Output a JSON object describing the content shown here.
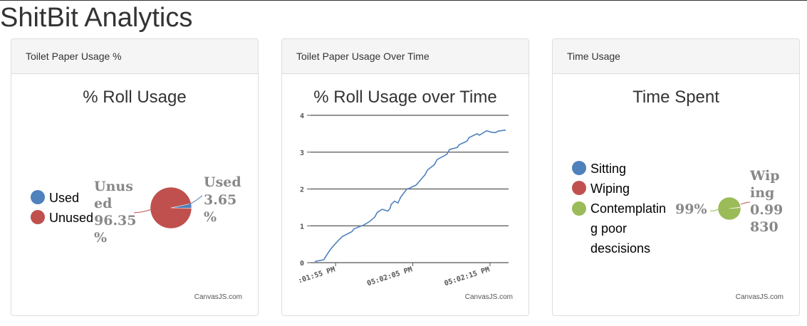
{
  "app": {
    "title": "ShitBit Analytics"
  },
  "panels": [
    {
      "heading": "Toilet Paper Usage %",
      "chart_title": "% Roll Usage",
      "credit": "CanvasJS.com"
    },
    {
      "heading": "Toilet Paper Usage Over Time",
      "chart_title": "% Roll Usage over Time",
      "credit": "CanvasJS.com"
    },
    {
      "heading": "Time Usage",
      "chart_title": "Time Spent",
      "credit": "CanvasJS.com"
    }
  ],
  "chart_data": [
    {
      "type": "pie",
      "title": "% Roll Usage",
      "legend_position": "left",
      "slices": [
        {
          "name": "Used",
          "value": 3.65,
          "color": "#4f81bc",
          "label_lines": [
            "Used",
            "3.65",
            "%"
          ]
        },
        {
          "name": "Unused",
          "value": 96.35,
          "color": "#c0504e",
          "label_lines": [
            "Unus",
            "ed",
            "96.35",
            "%"
          ]
        }
      ]
    },
    {
      "type": "line",
      "title": "% Roll Usage over Time",
      "ylim": [
        0,
        4
      ],
      "yticks": [
        "0",
        "1",
        "2",
        "3",
        "4"
      ],
      "xticks": [
        ":01:55 PM",
        "05:02:05 PM",
        "05:02:15 PM"
      ],
      "grid": true,
      "color": "#4f81bc",
      "series": [
        {
          "x": [
            0,
            1.6,
            2,
            2.6,
            3,
            4.3,
            4.9,
            6.6,
            7,
            8.7,
            9.8,
            10.7,
            11.1,
            11.5,
            12,
            13,
            13.4,
            13.6,
            14.2,
            14.8,
            15.3,
            16.4,
            16.9,
            17.2,
            18,
            19.6,
            20.1,
            21.3,
            21.8,
            23.5,
            24,
            25.4,
            25.7,
            27.1,
            27.5,
            28.9,
            29.3,
            30.6,
            31.5,
            32.2,
            32.6,
            34
          ],
          "y": [
            0.03,
            0.08,
            0.18,
            0.32,
            0.4,
            0.62,
            0.71,
            0.84,
            0.92,
            1.02,
            1.12,
            1.24,
            1.36,
            1.4,
            1.45,
            1.4,
            1.47,
            1.58,
            1.67,
            1.62,
            1.78,
            2,
            2.02,
            2.05,
            2.1,
            2.38,
            2.52,
            2.66,
            2.8,
            2.94,
            3.07,
            3.13,
            3.2,
            3.3,
            3.4,
            3.5,
            3.46,
            3.58,
            3.54,
            3.53,
            3.57,
            3.6
          ]
        }
      ]
    },
    {
      "type": "pie",
      "title": "Time Spent",
      "legend_position": "left",
      "slices": [
        {
          "name": "Sitting",
          "value": 0.0001,
          "color": "#4f81bc",
          "label_lines": []
        },
        {
          "name": "Wiping",
          "value": 0.9983,
          "color": "#c0504e",
          "label_lines": [
            "Wip",
            "ing",
            "0.99",
            "830"
          ]
        },
        {
          "name": "Contemplating poor descisions",
          "legend_lines": [
            "Contemplatin",
            "g poor",
            "descisions"
          ],
          "value": 99,
          "color": "#9bbb58",
          "label_lines": [
            "99%"
          ]
        }
      ]
    }
  ]
}
